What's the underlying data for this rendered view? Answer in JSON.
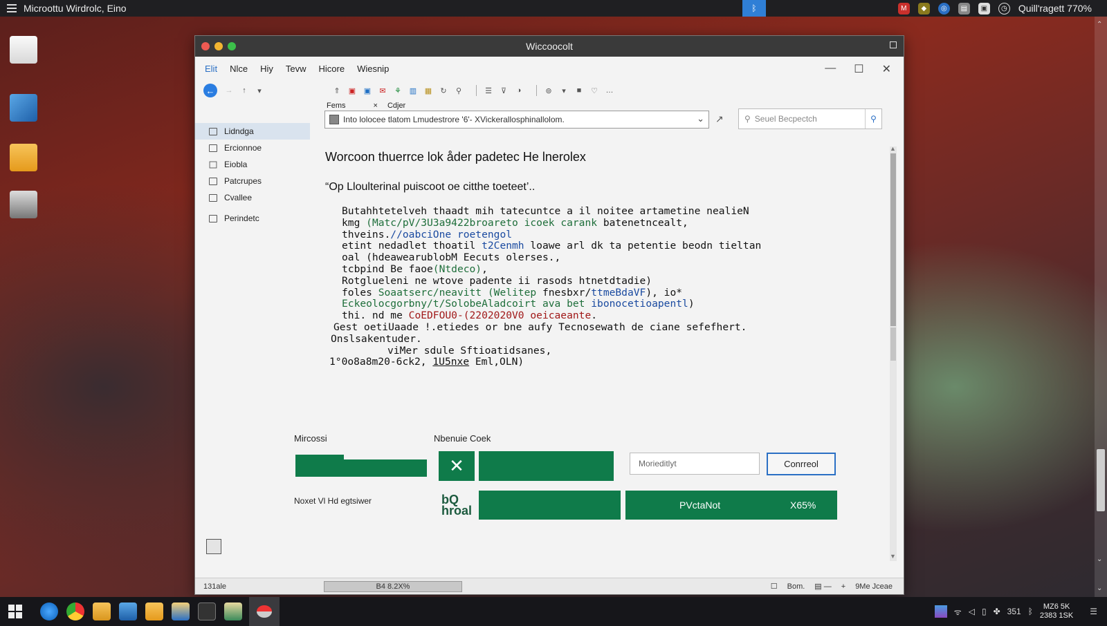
{
  "topbar": {
    "app_title": "Microottu Wirdrolc, Eino",
    "status": "Quill'ragett 770%"
  },
  "window": {
    "title": "Wiccoocolt",
    "menu": [
      "Elit",
      "Nlce",
      "Hiy",
      "Tevw",
      "Hicore",
      "Wiesnip"
    ],
    "tabs": [
      "Fems",
      "×",
      "Cdjer"
    ],
    "address": "Into lolocee tlatom Lmudestrore '6'- XVickerallosphinallolom.",
    "search_placeholder": "Seuel Becpectch"
  },
  "sidebar": {
    "items": [
      {
        "label": "Lidndga",
        "selected": true
      },
      {
        "label": "Ercionnoe"
      },
      {
        "label": "Eiobla"
      },
      {
        "label": "Patcrupes"
      },
      {
        "label": "Cvallee"
      },
      {
        "label": "Perindetc"
      }
    ]
  },
  "content": {
    "heading": "Worcoon thuerrce lok åder padetec He lnerolex",
    "quote": "“Op Lloulterinal puiscoot oe citthe toeteet’..",
    "code_lines": [
      [
        "Butahhtetelveh thaadt mih tatecuntce a il noitee artametine nealieN"
      ],
      [
        "kmg ",
        "(Matc/pV/3U3a9422broareto icoek carank",
        " batenetncealt,"
      ],
      [
        "thveins.",
        "//oabciOne roetengol"
      ],
      [
        "etint nedadlet thoatil ",
        "t2Cenmh",
        " loawe arl dk ta petentie beodn tieltan"
      ],
      [
        "oal (hdeawearublobM Eecuts olerses.,"
      ],
      [
        "tcbpind Be faoe",
        "(Ntdeco)",
        ","
      ],
      [
        "Rotglueleni ne wtove padente ii rasods htnetdtadie)"
      ],
      [
        "foles ",
        "Soaatserc/neavitt (Welitep",
        " fnesbxr/",
        "ttmeBdaVF",
        "), io*"
      ],
      [
        "Eckeolocgorbny/t/Solobe",
        "Aladcoirt ava bet ",
        "ibonocetioapentl",
        ")"
      ],
      [
        "thi. nd me ",
        "CoEDFOU0-(2202020V0 oeicaeante",
        "."
      ],
      [
        "Gest oetiUaade !.etiedes or bne aufy Tecnosewath de ciane sefefhert."
      ],
      [
        "Onslsakentuder."
      ],
      [
        "viMer sdule Sftioatidsanes,"
      ],
      [
        "1°0o8a8m20-",
        "6ck2,",
        " ",
        "1U5nxe",
        " Eml,OLN)"
      ]
    ]
  },
  "panel": {
    "label_left": "Mircossi",
    "label_mid": "Nbenuie Coek",
    "input_placeholder": "Morieditlyt",
    "button": "Conrreol",
    "label_bottom": "Noxet Vl Hd egtsiwer",
    "logo_text": "bQ\nhroal",
    "progress_label": "PVctaNot",
    "progress_value": "X65%"
  },
  "statusbar": {
    "left": "131ale",
    "progress": "B4 8.2X%",
    "right_a": "Bom.",
    "right_b": "9Me Jceae"
  },
  "taskbar": {
    "clock_time": "MZ6 5K",
    "clock_date": "2383 1SK",
    "tray_text": "351"
  },
  "colors": {
    "accent_green": "#0f7b4a",
    "accent_blue": "#2a6fc4"
  }
}
